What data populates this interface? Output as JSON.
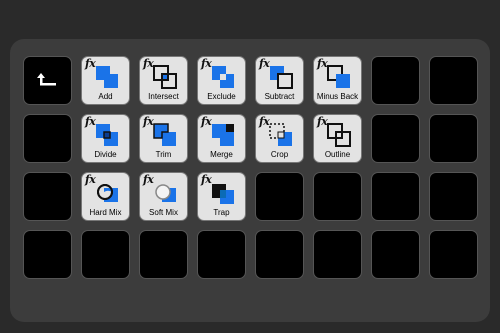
{
  "colors": {
    "accent": "#1a73e8",
    "key_bg": "#e3e3e3",
    "empty_key": "#000000",
    "panel": "#3c3c3c"
  },
  "keys": [
    {
      "label": "",
      "icon": "back-arrow-icon"
    },
    {
      "label": "Add",
      "icon": "add-icon"
    },
    {
      "label": "Intersect",
      "icon": "intersect-icon"
    },
    {
      "label": "Exclude",
      "icon": "exclude-icon"
    },
    {
      "label": "Subtract",
      "icon": "subtract-icon"
    },
    {
      "label": "Minus Back",
      "icon": "minus-back-icon"
    },
    {
      "label": "Divide",
      "icon": "divide-icon"
    },
    {
      "label": "Trim",
      "icon": "trim-icon"
    },
    {
      "label": "Merge",
      "icon": "merge-icon"
    },
    {
      "label": "Crop",
      "icon": "crop-icon"
    },
    {
      "label": "Outline",
      "icon": "outline-icon"
    },
    {
      "label": "Hard Mix",
      "icon": "hard-mix-icon"
    },
    {
      "label": "Soft Mix",
      "icon": "soft-mix-icon"
    },
    {
      "label": "Trap",
      "icon": "trap-icon"
    }
  ],
  "fx_label": "fx"
}
